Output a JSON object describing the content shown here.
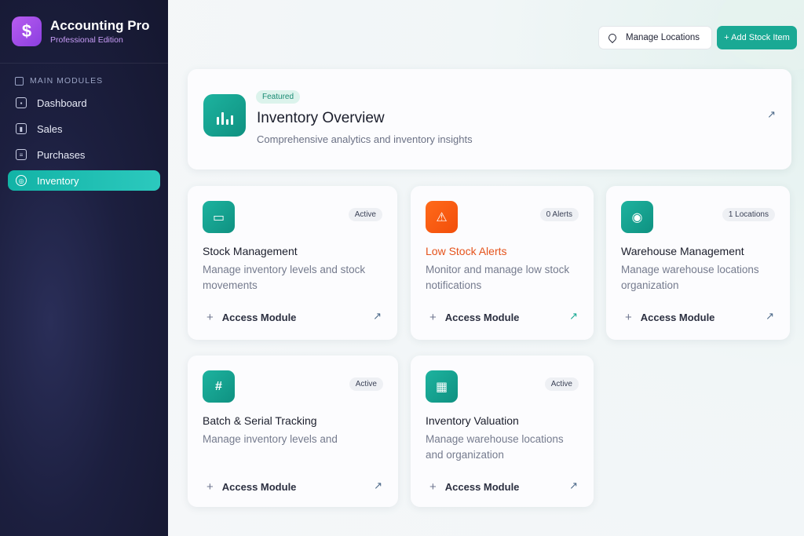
{
  "brand": {
    "logo_glyph": "$",
    "title": "Accounting Pro",
    "subtitle": "Professional Edition"
  },
  "sidebar": {
    "section_title": "MAIN MODULES",
    "items": [
      {
        "label": "Dashboard",
        "icon": "grid-icon",
        "active": false
      },
      {
        "label": "Sales",
        "icon": "bar-chart-icon",
        "active": false
      },
      {
        "label": "Purchases",
        "icon": "purchase-icon",
        "active": false
      },
      {
        "label": "Inventory",
        "icon": "inventory-icon",
        "active": true
      }
    ]
  },
  "header": {
    "manage_locations_label": "Manage Locations",
    "add_stock_label": "+ Add Stock Item"
  },
  "featured": {
    "badge": "Featured",
    "title": "Inventory Overview",
    "description": "Comprehensive analytics and inventory insights",
    "icon": "analytics-icon"
  },
  "modules": [
    {
      "title": "Stock Management",
      "badge": "Active",
      "description": "Manage inventory levels and stock movements",
      "access_label": "Access Module",
      "icon": "box-icon",
      "icon_glyph": "▭",
      "accent": "#14a594"
    },
    {
      "title": "Low Stock Alerts",
      "badge": "0 Alerts",
      "description": "Monitor and manage low stock notifications",
      "access_label": "Access Module",
      "icon": "warning-icon",
      "icon_glyph": "⚠",
      "accent": "#f25a10"
    },
    {
      "title": "Warehouse Management",
      "badge": "1 Locations",
      "description": "Manage warehouse locations organization",
      "access_label": "Access Module",
      "icon": "location-pin-icon",
      "icon_glyph": "◉",
      "accent": "#14a594"
    },
    {
      "title": "Batch & Serial Tracking",
      "badge": "Active",
      "description": "Manage inventory levels and",
      "access_label": "Access Module",
      "icon": "hash-icon",
      "icon_glyph": "#",
      "accent": "#14a594"
    },
    {
      "title": "Inventory Valuation",
      "badge": "Active",
      "description": "Manage warehouse locations and organization",
      "access_label": "Access Module",
      "icon": "calculator-icon",
      "icon_glyph": "▦",
      "accent": "#14a594"
    }
  ]
}
